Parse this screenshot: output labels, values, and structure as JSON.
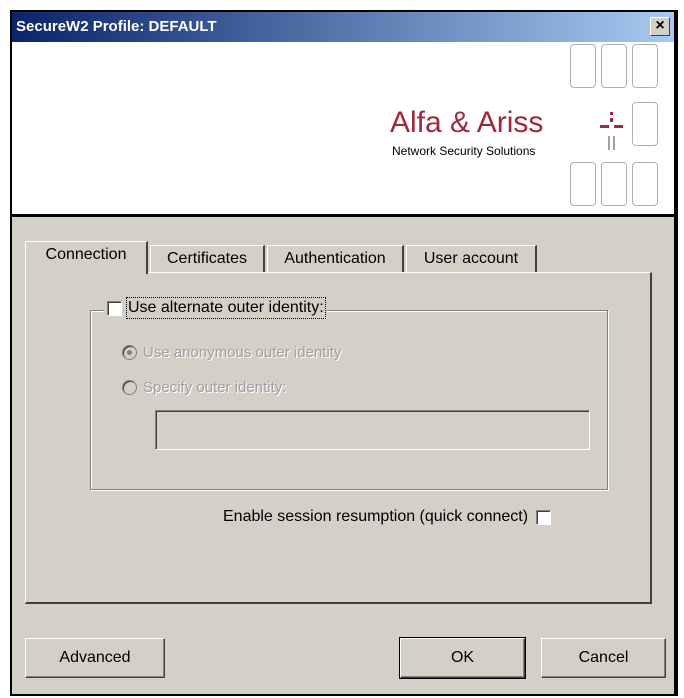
{
  "window": {
    "title": "SecureW2 Profile: DEFAULT",
    "close_glyph": "×"
  },
  "banner": {
    "brand_name": "Alfa & Ariss",
    "brand_tagline": "Network Security Solutions",
    "brand_color": "#a0283a"
  },
  "tabs": [
    {
      "label": "Connection",
      "active": true
    },
    {
      "label": "Certificates",
      "active": false
    },
    {
      "label": "Authentication",
      "active": false
    },
    {
      "label": "User account",
      "active": false
    }
  ],
  "connection": {
    "alternate_identity_label": "Use alternate outer identity:",
    "alternate_identity_checked": false,
    "radio_anonymous_label": "Use anonymous outer identity",
    "radio_anonymous_selected": true,
    "radio_specify_label": "Specify outer identity:",
    "radio_specify_selected": false,
    "outer_identity_value": "",
    "session_resumption_label": "Enable session resumption (quick connect)",
    "session_resumption_checked": false
  },
  "buttons": {
    "advanced": "Advanced",
    "ok": "OK",
    "cancel": "Cancel"
  },
  "colors": {
    "title_gradient_start": "#0a246a",
    "title_gradient_end": "#a6caf0",
    "dialog_face": "#d4d0c8"
  },
  "icons": {
    "close": "close-icon",
    "brand_logo": "alfa-ariss-logo-icon"
  }
}
